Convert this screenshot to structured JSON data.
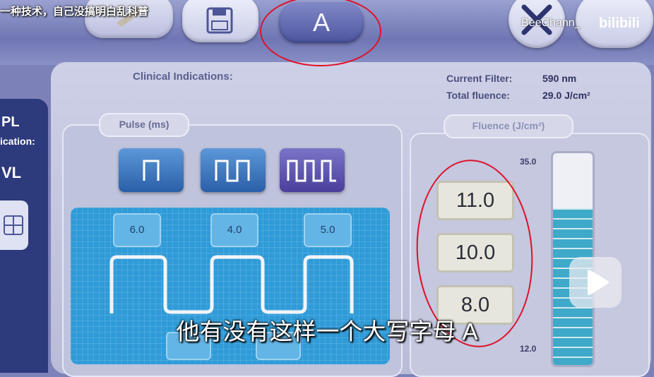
{
  "caption_top": "一种技术，自己没搞明白乱科普",
  "toolbar": {
    "text_button_glyph": "A"
  },
  "watermark": {
    "author": "BeeChann_",
    "platform": "bilibili"
  },
  "left_panel": {
    "ipl": "PL",
    "indication": "ication:",
    "mode": "VL"
  },
  "header": {
    "clinical_indications_label": "Clinical Indications:",
    "current_filter_label": "Current Filter:",
    "current_filter_value": "590  nm",
    "total_fluence_label": "Total fluence:",
    "total_fluence_value": "29.0  J/cm²"
  },
  "pulse": {
    "section_label": "Pulse (ms)",
    "durations": [
      "6.0",
      "4.0",
      "5.0"
    ],
    "pulse_count_options": [
      1,
      2,
      3
    ],
    "selected_pulse_count": 3
  },
  "fluence": {
    "section_label": "Fluence  (J/cm²)",
    "values": [
      "11.0",
      "10.0",
      "8.0"
    ],
    "scale_max": "35.0",
    "scale_min": "12.0",
    "gauge_level": 29.0
  },
  "subtitle": "他有没有这样一个大写字母 A",
  "colors": {
    "annotation_ring": "#e0102a",
    "wave_area": "#2f9bd8",
    "selected_button": "#4a3f9c"
  }
}
